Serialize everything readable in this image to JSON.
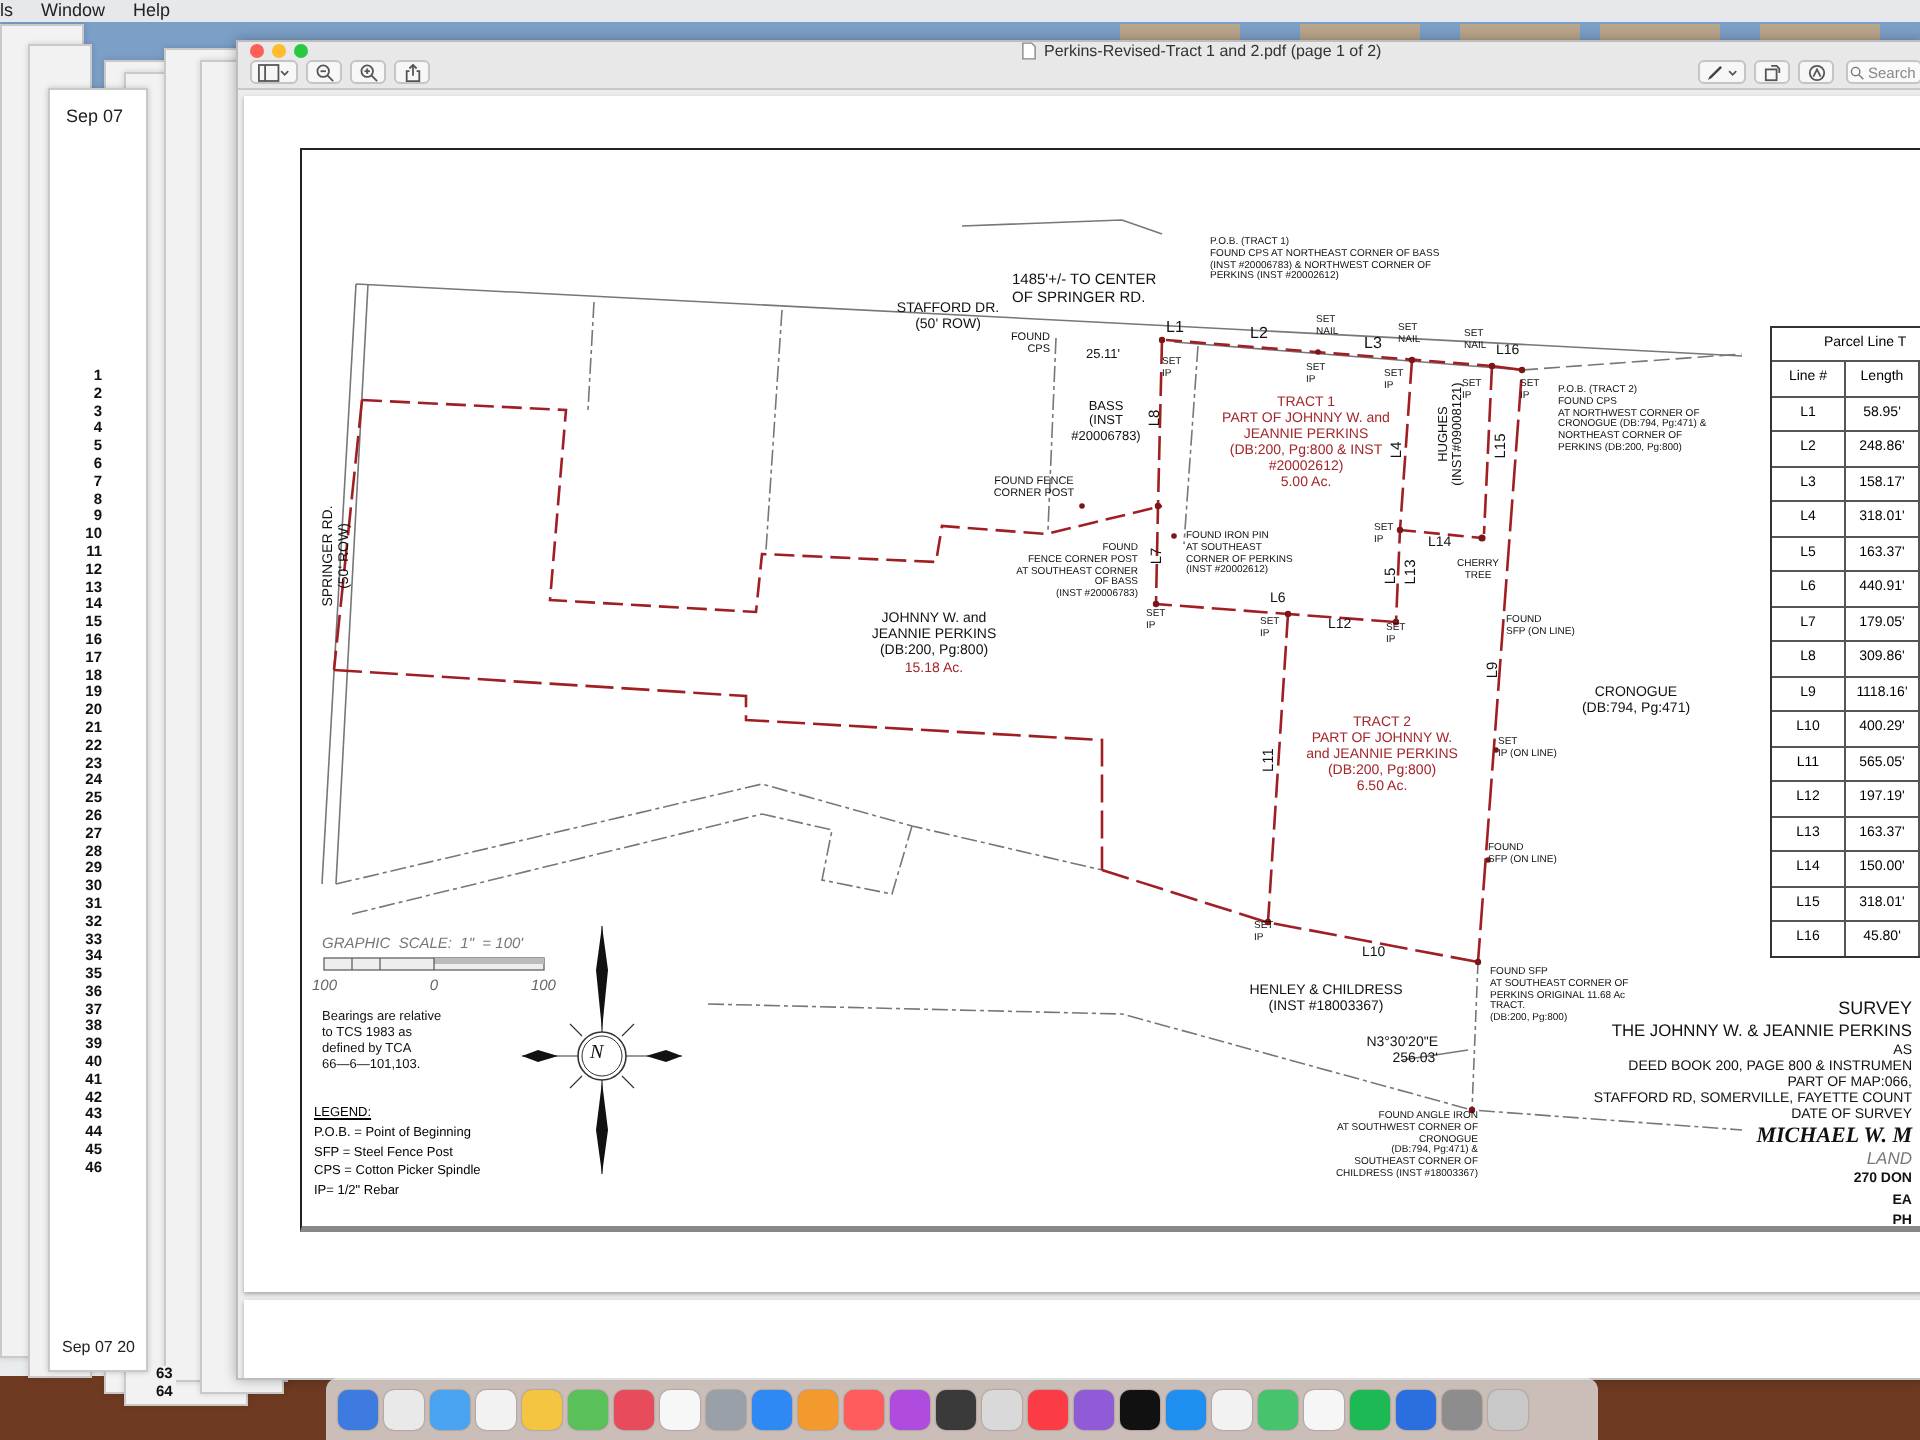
{
  "menubar": {
    "items": [
      "ls",
      "Window",
      "Help"
    ]
  },
  "background_document": {
    "header_date": "Sep 07",
    "line_numbers": [
      "1",
      "2",
      "3",
      "4",
      "5",
      "6",
      "7",
      "8",
      "9",
      "10",
      "11",
      "12",
      "13",
      "14",
      "15",
      "16",
      "17",
      "18",
      "19",
      "20",
      "21",
      "22",
      "23",
      "24",
      "25",
      "26",
      "27",
      "28",
      "29",
      "30",
      "31",
      "32",
      "33",
      "34",
      "35",
      "36",
      "37",
      "38",
      "39",
      "40",
      "41",
      "42",
      "43",
      "44",
      "45",
      "46"
    ],
    "footer_date": "Sep 07 20",
    "footer_numbers": [
      "63",
      "64"
    ]
  },
  "window": {
    "title": "Perkins-Revised-Tract 1 and 2.pdf (page 1 of 2)",
    "search": {
      "placeholder": "Search"
    }
  },
  "survey": {
    "labels": [
      {
        "text": "1485'+/- TO CENTER\nOF SPRINGER RD.",
        "kind": "name"
      },
      {
        "text": "STAFFORD DR.\n(50' ROW)",
        "kind": "name"
      },
      {
        "text": "FOUND\nCPS",
        "kind": "note"
      },
      {
        "text": "25.11'",
        "kind": "name"
      },
      {
        "text": "BASS\n(INST\n#20006783)",
        "kind": "name"
      },
      {
        "text": "L8",
        "kind": "line"
      },
      {
        "text": "FOUND FENCE\nCORNER POST",
        "kind": "note"
      },
      {
        "text": "FOUND\nFENCE CORNER POST\nAT SOUTHEAST CORNER\nOF BASS\n(INST #20006783)",
        "kind": "note"
      },
      {
        "text": "L7",
        "kind": "line"
      },
      {
        "text": "JOHNNY W. and\nJEANNIE PERKINS\n(DB:200, Pg:800)",
        "kind": "name"
      },
      {
        "text": "15.18 Ac.",
        "kind": "tract"
      },
      {
        "text": "SPRINGER RD.\n(50' ROW)",
        "kind": "name"
      },
      {
        "text": "P.O.B. (TRACT 1)\nFOUND CPS AT NORTHEAST CORNER OF BASS\n(INST #20006783) & NORTHWEST CORNER OF\nPERKINS (INST #20002612)",
        "kind": "note"
      },
      {
        "text": "L1",
        "kind": "line"
      },
      {
        "text": "SET\nIP",
        "kind": "note"
      },
      {
        "text": "L2",
        "kind": "line"
      },
      {
        "text": "SET\nNAIL",
        "kind": "note"
      },
      {
        "text": "SET\nIP",
        "kind": "note"
      },
      {
        "text": "L3",
        "kind": "line"
      },
      {
        "text": "SET\nNAIL",
        "kind": "note"
      },
      {
        "text": "SET\nIP",
        "kind": "note"
      },
      {
        "text": "SET\nNAIL",
        "kind": "note"
      },
      {
        "text": "L16",
        "kind": "line"
      },
      {
        "text": "SET\nIP",
        "kind": "note"
      },
      {
        "text": "SET\nIP",
        "kind": "note"
      },
      {
        "text": "P.O.B. (TRACT 2)\nFOUND CPS\nAT NORTHWEST CORNER OF\nCRONOGUE (DB:794, Pg:471) &\nNORTHEAST CORNER OF\nPERKINS (DB:200, Pg:800)",
        "kind": "note"
      },
      {
        "text": "TRACT 1\nPART OF JOHNNY W. and\nJEANNIE PERKINS\n(DB:200, Pg:800 & INST\n#20002612)\n5.00 Ac.",
        "kind": "tract"
      },
      {
        "text": "L4",
        "kind": "line"
      },
      {
        "text": "HUGHES\n(INST#09008121)",
        "kind": "name"
      },
      {
        "text": "L15",
        "kind": "line"
      },
      {
        "text": "FOUND IRON PIN\nAT SOUTHEAST\nCORNER OF PERKINS\n(INST #20002612)",
        "kind": "note"
      },
      {
        "text": "SET\nIP",
        "kind": "note"
      },
      {
        "text": "L14",
        "kind": "line"
      },
      {
        "text": "CHERRY\nTREE",
        "kind": "note"
      },
      {
        "text": "L5",
        "kind": "line"
      },
      {
        "text": "L13",
        "kind": "line"
      },
      {
        "text": "SET\nIP",
        "kind": "note"
      },
      {
        "text": "L6",
        "kind": "line"
      },
      {
        "text": "SET\nIP",
        "kind": "note"
      },
      {
        "text": "L12",
        "kind": "line"
      },
      {
        "text": "SET\nIP",
        "kind": "note"
      },
      {
        "text": "FOUND\nSFP (ON LINE)",
        "kind": "note"
      },
      {
        "text": "L9",
        "kind": "line"
      },
      {
        "text": "CRONOGUE\n(DB:794, Pg:471)",
        "kind": "name"
      },
      {
        "text": "TRACT 2\nPART OF JOHNNY W.\nand JEANNIE PERKINS\n(DB:200, Pg:800)\n6.50 Ac.",
        "kind": "tract"
      },
      {
        "text": "L11",
        "kind": "line"
      },
      {
        "text": "SET\nIP (ON LINE)",
        "kind": "note"
      },
      {
        "text": "FOUND\nSFP (ON LINE)",
        "kind": "note"
      },
      {
        "text": "SET\nIP",
        "kind": "note"
      },
      {
        "text": "L10",
        "kind": "line"
      },
      {
        "text": "HENLEY & CHILDRESS\n(INST #18003367)",
        "kind": "name"
      },
      {
        "text": "FOUND SFP\nAT SOUTHEAST CORNER OF\nPERKINS ORIGINAL 11.68 Ac\nTRACT.\n(DB:200, Pg:800)",
        "kind": "note"
      },
      {
        "text": "N3°30'20\"E\n256.03'",
        "kind": "name"
      },
      {
        "text": "FOUND ANGLE IRON\nAT SOUTHWEST CORNER OF\nCRONOGUE\n(DB:794, Pg:471) &\nSOUTHEAST CORNER OF\nCHILDRESS (INST #18003367)",
        "kind": "note"
      }
    ],
    "line_table": {
      "title": "Parcel Line T",
      "columns": [
        "Line #",
        "Length"
      ],
      "rows": [
        [
          "L1",
          "58.95'"
        ],
        [
          "L2",
          "248.86'"
        ],
        [
          "L3",
          "158.17'"
        ],
        [
          "L4",
          "318.01'"
        ],
        [
          "L5",
          "163.37'"
        ],
        [
          "L6",
          "440.91'"
        ],
        [
          "L7",
          "179.05'"
        ],
        [
          "L8",
          "309.86'"
        ],
        [
          "L9",
          "1118.16'"
        ],
        [
          "L10",
          "400.29'"
        ],
        [
          "L11",
          "565.05'"
        ],
        [
          "L12",
          "197.19'"
        ],
        [
          "L13",
          "163.37'"
        ],
        [
          "L14",
          "150.00'"
        ],
        [
          "L15",
          "318.01'"
        ],
        [
          "L16",
          "45.80'"
        ]
      ]
    },
    "scale": {
      "title": "GRAPHIC  SCALE:  1\"  = 100'",
      "ticks": [
        "100",
        "0",
        "100"
      ]
    },
    "compass": {
      "letter": "N"
    },
    "bearings_note": "Bearings are relative\nto TCS 1983 as\ndefined by TCA\n66—6—101,103.",
    "legend": {
      "title": "LEGEND:",
      "items": [
        "P.O.B. = Point of Beginning",
        "SFP = Steel Fence Post",
        "CPS = Cotton Picker Spindle",
        "IP= 1/2\" Rebar"
      ]
    },
    "title_block": [
      "SURVEY",
      "THE JOHNNY W. & JEANNIE PERKINS",
      "AS",
      "DEED BOOK 200, PAGE 800 & INSTRUMEN",
      "PART OF MAP:066,",
      "STAFFORD RD, SOMERVILLE, FAYETTE COUNT",
      "DATE OF SURVEY",
      "MICHAEL W. M",
      "LAND",
      "270 DON",
      "EA",
      "PH"
    ]
  }
}
